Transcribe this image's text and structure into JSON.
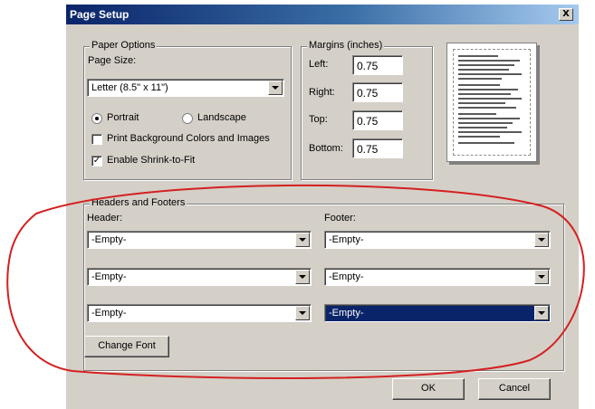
{
  "window": {
    "title": "Page Setup",
    "close_label": "X"
  },
  "paper_options": {
    "group_label": "Paper Options",
    "page_size_label": "Page Size:",
    "page_size_value": "Letter (8.5\" x 11\")",
    "orientation": {
      "portrait_label": "Portrait",
      "landscape_label": "Landscape",
      "selected": "portrait"
    },
    "print_background": {
      "label": "Print Background Colors and Images",
      "checked": false,
      "mark": ""
    },
    "shrink_to_fit": {
      "label": "Enable Shrink-to-Fit",
      "checked": true,
      "mark": "✓"
    }
  },
  "margins": {
    "group_label": "Margins (inches)",
    "fields": [
      {
        "label": "Left:",
        "value": "0.75"
      },
      {
        "label": "Right:",
        "value": "0.75"
      },
      {
        "label": "Top:",
        "value": "0.75"
      },
      {
        "label": "Bottom:",
        "value": "0.75"
      }
    ]
  },
  "headers_footers": {
    "group_label": "Headers and Footers",
    "header_label": "Header:",
    "footer_label": "Footer:",
    "header_values": [
      "-Empty-",
      "-Empty-",
      "-Empty-"
    ],
    "footer_values": [
      "-Empty-",
      "-Empty-",
      "-Empty-"
    ],
    "change_font_label": "Change Font"
  },
  "buttons": {
    "ok_label": "OK",
    "cancel_label": "Cancel"
  },
  "colors": {
    "dialog_face": "#d4d0c8",
    "title_bar": "#0a246a",
    "selection": "#0a246a",
    "annotation": "#d42020"
  },
  "icons": {
    "close": "close-icon",
    "dropdown": "chevron-down-icon",
    "preview": "page-preview-icon"
  }
}
